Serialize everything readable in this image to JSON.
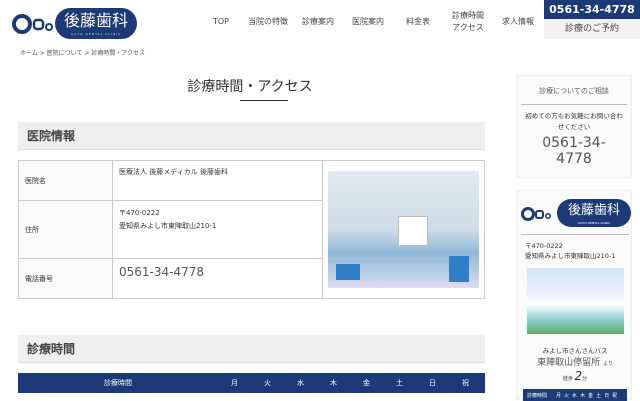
{
  "header": {
    "logo_text": "後藤歯科",
    "logo_sub": "GOTO DENTAL CLINIC",
    "nav": [
      "TOP",
      "当院の特徴",
      "診療案内",
      "医院案内",
      "料金表",
      "診療時間\nアクセス",
      "求人情報"
    ],
    "phone": "0561-34-4778",
    "reserve": "診療のご予約"
  },
  "breadcrumb": [
    "ホーム",
    "医院について",
    "診療時間・アクセス"
  ],
  "page_title": "診療時間・アクセス",
  "info": {
    "heading": "医院情報",
    "rows": [
      {
        "label": "医院名",
        "value": "医療法人 後藤メディカル 後藤歯科"
      },
      {
        "label": "住所",
        "value": "〒470-0222\n愛知県みよし市東陣取山210-1"
      },
      {
        "label": "電話番号",
        "value": "0561-34-4778"
      }
    ]
  },
  "hours": {
    "heading": "診療時間",
    "header": [
      "診療時間",
      "月",
      "火",
      "水",
      "木",
      "金",
      "土",
      "日",
      "祝"
    ]
  },
  "sidebar": {
    "consult_title": "診療についてのご相談",
    "consult_text": "初めての方もお気軽にお問い合わせください",
    "phone": "0561-34-4778",
    "logo_text": "後藤歯科",
    "logo_sub": "GOTO DENTAL CLINIC",
    "address": "〒470-0222\n愛知県みよし市東陣取山210-1",
    "bus": "みよし市さんさんバス",
    "stop": "東陣取山停留所",
    "yori": "より",
    "walk": "徒歩",
    "minutes": "2",
    "fun": "分",
    "mini_header": [
      "診療時間",
      "月",
      "火",
      "水",
      "木",
      "金",
      "土",
      "日",
      "祝"
    ]
  }
}
